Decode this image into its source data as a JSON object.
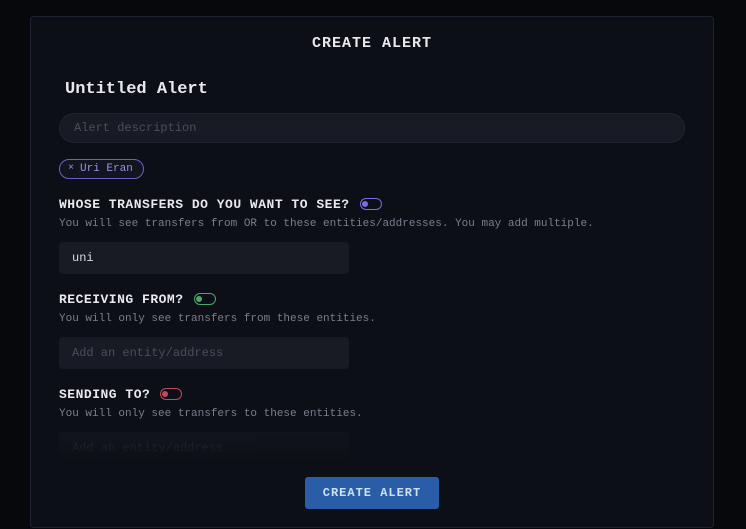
{
  "modal": {
    "title": "CREATE ALERT",
    "submit_label": "CREATE ALERT"
  },
  "alert": {
    "title_value": "Untitled Alert",
    "description_placeholder": "Alert description",
    "description_value": ""
  },
  "chips": [
    {
      "label": "Uri Eran"
    }
  ],
  "sections": {
    "whose": {
      "heading": "WHOSE TRANSFERS DO YOU WANT TO SEE?",
      "description": "You will see transfers from OR to these entities/addresses. You may add multiple.",
      "input_value": "uni",
      "input_placeholder": "Add an entity/address"
    },
    "from": {
      "heading": "RECEIVING FROM?",
      "description": "You will only see transfers from these entities.",
      "input_value": "",
      "input_placeholder": "Add an entity/address"
    },
    "to": {
      "heading": "SENDING TO?",
      "description": "You will only see transfers to these entities.",
      "input_value": "",
      "input_placeholder": "Add an entity/address"
    }
  }
}
